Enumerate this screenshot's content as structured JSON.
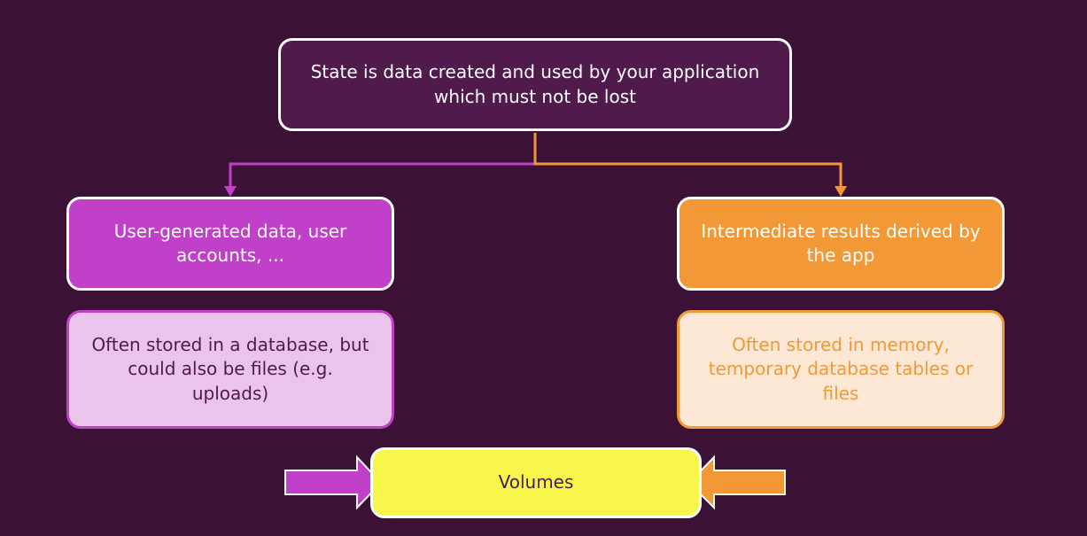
{
  "nodes": {
    "state_definition": "State is data created and used by your application which must not be lost",
    "user_data": "User-generated data, user accounts, ...",
    "user_storage": "Often stored in a database, but could also be files (e.g. uploads)",
    "intermediate_results": "Intermediate results derived by the app",
    "intermediate_storage": "Often stored in memory, temporary database tables or files",
    "volumes": "Volumes"
  },
  "colors": {
    "background": "#3b1236",
    "state_box": "#501a4d",
    "user_accent": "#c040c9",
    "user_light": "#ebc4ec",
    "intermediate_accent": "#f29836",
    "intermediate_light": "#fde8d6",
    "volumes": "#f8f64b"
  }
}
